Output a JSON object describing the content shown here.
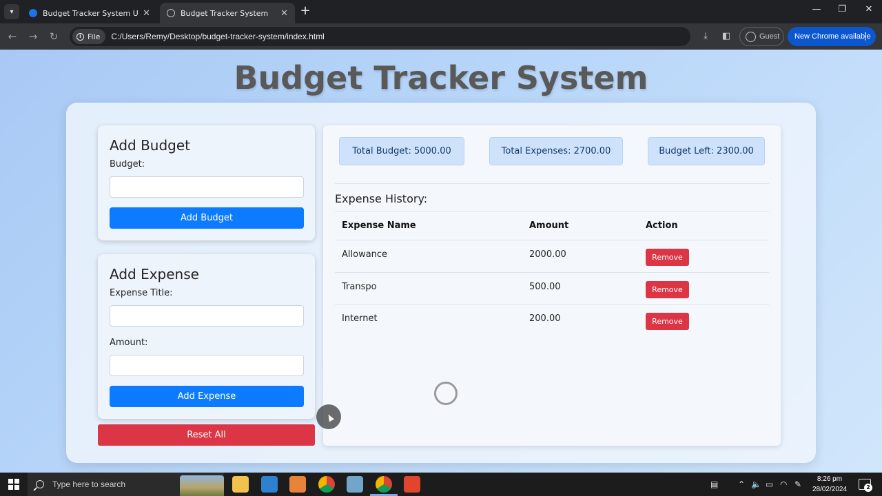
{
  "browser": {
    "tabs": [
      {
        "title": "Budget Tracker System Using H",
        "active": false
      },
      {
        "title": "Budget Tracker System",
        "active": true
      }
    ],
    "file_chip": "File",
    "url": "C:/Users/Remy/Desktop/budget-tracker-system/index.html",
    "profile_label": "Guest",
    "update_label": "New Chrome available"
  },
  "page": {
    "title": "Budget Tracker System",
    "add_budget": {
      "heading": "Add Budget",
      "budget_label": "Budget:",
      "budget_value": "",
      "button": "Add Budget"
    },
    "add_expense": {
      "heading": "Add Expense",
      "title_label": "Expense Title:",
      "title_value": "",
      "amount_label": "Amount:",
      "amount_value": "",
      "button": "Add Expense"
    },
    "reset_button": "Reset All",
    "stats": {
      "total_budget": "Total Budget: 5000.00",
      "total_expenses": "Total Expenses: 2700.00",
      "budget_left": "Budget Left: 2300.00"
    },
    "history": {
      "title": "Expense History:",
      "columns": [
        "Expense Name",
        "Amount",
        "Action"
      ],
      "rows": [
        {
          "name": "Allowance",
          "amount": "2000.00",
          "action": "Remove"
        },
        {
          "name": "Transpo",
          "amount": "500.00",
          "action": "Remove"
        },
        {
          "name": "Internet",
          "amount": "200.00",
          "action": "Remove"
        }
      ]
    }
  },
  "taskbar": {
    "search_placeholder": "Type here to search",
    "time": "8:26 pm",
    "date": "28/02/2024",
    "notification_count": "2"
  },
  "colors": {
    "primary_button": "#0d7bff",
    "danger_button": "#dc3545",
    "stat_bg": "#cfe2fb",
    "chrome_update": "#0b57d0"
  }
}
